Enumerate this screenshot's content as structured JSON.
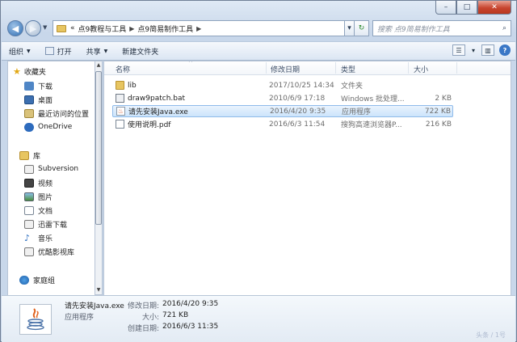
{
  "window": {
    "caption": {
      "minimize": "–",
      "maximize": "□",
      "close": "✕"
    }
  },
  "address": {
    "overflow": "«",
    "crumbs": [
      "点9教程与工具",
      "点9简易制作工具"
    ],
    "search_placeholder": "搜索 点9简易制作工具"
  },
  "toolbar": {
    "organize": "组织",
    "open": "打开",
    "share": "共享",
    "new_folder": "新建文件夹"
  },
  "sidebar": {
    "favorites_label": "收藏夹",
    "favorites": [
      "下载",
      "桌面",
      "最近访问的位置",
      "OneDrive"
    ],
    "library_label": "库",
    "libraries": [
      "Subversion",
      "视频",
      "图片",
      "文档",
      "迅雷下载",
      "音乐",
      "优酷影视库"
    ],
    "homegroup_label": "家庭组"
  },
  "columns": {
    "name": "名称",
    "date": "修改日期",
    "type": "类型",
    "size": "大小"
  },
  "files": [
    {
      "name": "lib",
      "date": "2017/10/25 14:34",
      "type": "文件夹",
      "size": "",
      "icon": "folder-icon",
      "selected": false
    },
    {
      "name": "draw9patch.bat",
      "date": "2010/6/9 17:18",
      "type": "Windows 批处理...",
      "size": "2 KB",
      "icon": "batch-file-icon",
      "selected": false
    },
    {
      "name": "请先安装Java.exe",
      "date": "2016/4/20 9:35",
      "type": "应用程序",
      "size": "722 KB",
      "icon": "java-icon",
      "selected": true
    },
    {
      "name": "使用说明.pdf",
      "date": "2016/6/3 11:54",
      "type": "搜狗高速浏览器P...",
      "size": "216 KB",
      "icon": "pdf-file-icon",
      "selected": false
    }
  ],
  "details": {
    "name": "请先安装Java.exe",
    "type": "应用程序",
    "modified_label": "修改日期:",
    "modified": "2016/4/20 9:35",
    "size_label": "大小:",
    "size": "721 KB",
    "created_label": "创建日期:",
    "created": "2016/6/3 11:35"
  },
  "watermark": "头条 / 1号",
  "colors": {
    "selection": "#cce4fb",
    "selection_border": "#8fbbea",
    "folder": "#e7c561",
    "close_button": "#c8452f",
    "secondary_text": "#6d6d6d"
  }
}
